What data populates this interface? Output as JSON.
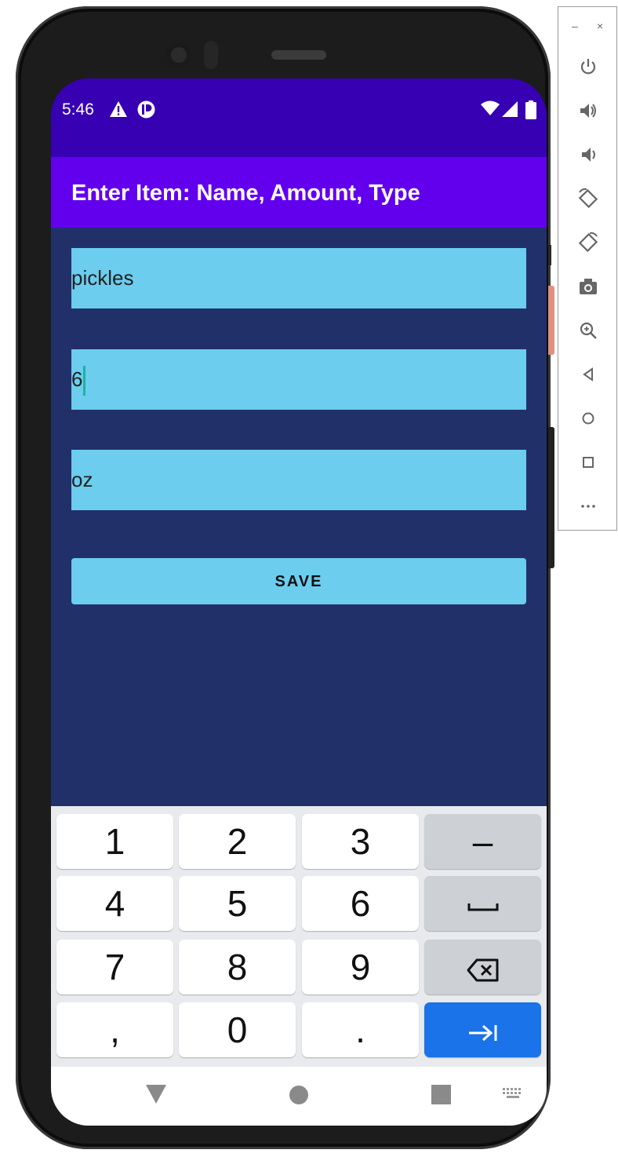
{
  "status_bar": {
    "time": "5:46"
  },
  "app_bar": {
    "title": "Enter Item: Name, Amount, Type"
  },
  "form": {
    "name_value": "pickles",
    "amount_value": "6",
    "type_value": "oz",
    "save_label": "SAVE"
  },
  "keyboard": {
    "rows": [
      [
        "1",
        "2",
        "3",
        "–"
      ],
      [
        "4",
        "5",
        "6",
        "space"
      ],
      [
        "7",
        "8",
        "9",
        "backspace"
      ],
      [
        ",",
        "0",
        ".",
        "next"
      ]
    ],
    "k1": "1",
    "k2": "2",
    "k3": "3",
    "kdash": "–",
    "k4": "4",
    "k5": "5",
    "k6": "6",
    "k7": "7",
    "k8": "8",
    "k9": "9",
    "kcomma": ",",
    "k0": "0",
    "kdot": ".",
    "action_color": "#1a73e8"
  },
  "colors": {
    "status_bar": "#3700b3",
    "app_bar": "#6200ee",
    "background": "#22306a",
    "field": "#6ccdee"
  },
  "emulator_panel": {
    "minimize": "–",
    "close": "×",
    "icons": [
      "power-icon",
      "volume-up-icon",
      "volume-down-icon",
      "rotate-left-icon",
      "rotate-right-icon",
      "camera-icon",
      "zoom-icon",
      "back-icon",
      "home-icon",
      "overview-icon",
      "more-icon"
    ]
  },
  "nav_bar": {
    "icons": [
      "back-triangle-icon",
      "home-circle-icon",
      "recents-square-icon",
      "keyboard-switch-icon"
    ]
  }
}
